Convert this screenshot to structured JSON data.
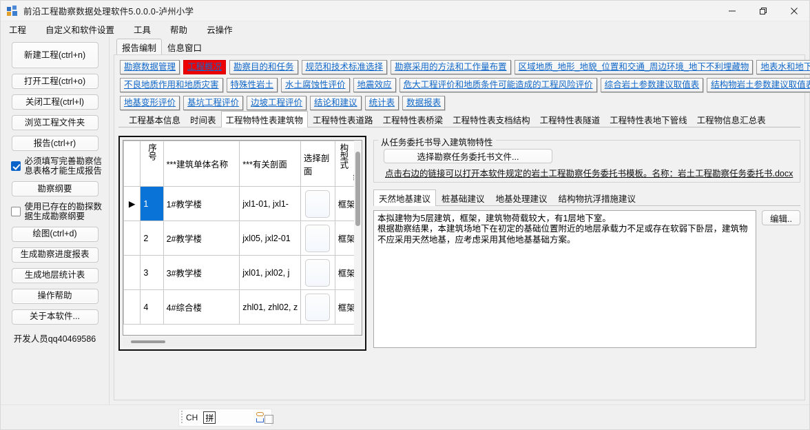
{
  "window": {
    "title": "前沿工程勘察数据处理软件5.0.0.0-泸州小学",
    "minimize": "—",
    "maximize": "❐",
    "close": "✕"
  },
  "menubar": {
    "items": [
      {
        "label": "工程"
      },
      {
        "label": "自定义和软件设置"
      },
      {
        "label": "工具"
      },
      {
        "label": "帮助"
      },
      {
        "label": "云操作"
      }
    ]
  },
  "sidebar": {
    "buttons": [
      {
        "label": "新建工程(ctrl+n)"
      },
      {
        "label": "打开工程(ctrl+o)"
      },
      {
        "label": "关闭工程(ctrl+l)"
      },
      {
        "label": "浏览工程文件夹"
      },
      {
        "label": "报告(ctrl+r)"
      }
    ],
    "checkbox_required": {
      "label": "必须填写完善勘察信息表格才能生成报告",
      "checked": true
    },
    "outline_button": {
      "label": "勘察纲要"
    },
    "checkbox_existing": {
      "label": "使用已存在的勘探数据生成勘察纲要",
      "checked": false
    },
    "buttons2": [
      {
        "label": "绘图(ctrl+d)"
      },
      {
        "label": "生成勘察进度报表"
      },
      {
        "label": "生成地层统计表"
      },
      {
        "label": "操作帮助"
      },
      {
        "label": "关于本软件..."
      }
    ],
    "developer": "开发人员qq40469586"
  },
  "outer_tabs": [
    {
      "label": "报告编制",
      "active": true
    },
    {
      "label": "信息窗口",
      "active": false
    }
  ],
  "nav_rows": [
    [
      {
        "label": "勘察数据管理",
        "hot": false
      },
      {
        "label": "工程概况",
        "hot": true
      },
      {
        "label": "勘察目的和任务",
        "hot": false
      },
      {
        "label": "规范和技术标准选择",
        "hot": false
      },
      {
        "label": "勘察采用的方法和工作量布置",
        "hot": false
      },
      {
        "label": "区域地质_地形_地貌_位置和交通_周边环境_地下不利埋藏物",
        "hot": false
      },
      {
        "label": "地表水和地下水",
        "hot": false
      }
    ],
    [
      {
        "label": "不良地质作用和地质灾害",
        "hot": false
      },
      {
        "label": "特殊性岩土",
        "hot": false
      },
      {
        "label": "水土腐蚀性评价",
        "hot": false
      },
      {
        "label": "地震效应",
        "hot": false
      },
      {
        "label": "危大工程评价和地质条件可能造成的工程风险评价",
        "hot": false
      },
      {
        "label": "综合岩土参数建议取值表",
        "hot": false
      },
      {
        "label": "结构物岩土参数建议取值表",
        "hot": false
      }
    ],
    [
      {
        "label": "地基变形评价",
        "hot": false
      },
      {
        "label": "基坑工程评价",
        "hot": false
      },
      {
        "label": "边坡工程评价",
        "hot": false
      },
      {
        "label": "结论和建议",
        "hot": false
      },
      {
        "label": "统计表",
        "hot": false
      },
      {
        "label": "数据报表",
        "hot": false
      }
    ]
  ],
  "inner_tabs": [
    {
      "label": "工程基本信息",
      "active": false
    },
    {
      "label": "时间表",
      "active": false
    },
    {
      "label": "工程物特性表建筑物",
      "active": true
    },
    {
      "label": "工程特性表道路",
      "active": false
    },
    {
      "label": "工程特性表桥梁",
      "active": false
    },
    {
      "label": "工程特性表支档结构",
      "active": false
    },
    {
      "label": "工程特性表隧道",
      "active": false
    },
    {
      "label": "工程特性表地下管线",
      "active": false
    },
    {
      "label": "工程物信息汇总表",
      "active": false
    }
  ],
  "grid": {
    "headers": [
      "",
      "序号",
      "***建筑单体名称",
      "***有关剖面",
      "选择剖面",
      "***结构型式"
    ],
    "rows": [
      {
        "indicator": "▶",
        "no": "1",
        "name": "1#教学楼",
        "sections": "jxl1-01, jxl1-",
        "pick": "",
        "type": "框架",
        "selected": true
      },
      {
        "indicator": "",
        "no": "2",
        "name": "2#教学楼",
        "sections": "jxl05, jxl2-01",
        "pick": "",
        "type": "框架",
        "selected": false
      },
      {
        "indicator": "",
        "no": "3",
        "name": "3#教学楼",
        "sections": "jxl01, jxl02, j",
        "pick": "",
        "type": "框架",
        "selected": false
      },
      {
        "indicator": "",
        "no": "4",
        "name": "4#综合楼",
        "sections": "zhl01, zhl02, z",
        "pick": "",
        "type": "框架",
        "selected": false
      }
    ]
  },
  "import_group": {
    "legend": "从任务委托书导入建筑物特性",
    "choose_button": "选择勘察任务委托书文件...",
    "template_link": "点击右边的链接可以打开本软件规定的岩土工程勘察任务委托书模板。名称：岩土工程勘察任务委托书.docx"
  },
  "suggestion_tabs": [
    {
      "label": "天然地基建议",
      "active": true
    },
    {
      "label": "桩基础建议",
      "active": false
    },
    {
      "label": "地基处理建议",
      "active": false
    },
    {
      "label": "结构物抗浮措施建议",
      "active": false
    }
  ],
  "suggestion_text": "本拟建物为5层建筑，框架，建筑物荷载较大，有1层地下室。\n根据勘察结果，本建筑场地下在初定的基础位置附近的地层承载力不足或存在软弱下卧层，建筑物不应采用天然地基，应考虑采用其他地基基础方案。",
  "edit_button": "编辑..",
  "statusbar": {
    "ime_mode": "CH",
    "ime_pinyin": "拼"
  },
  "colors": {
    "accent_blue": "#1268c8",
    "hot_red": "#ee0000",
    "selection_blue": "#0a73d8",
    "checkbox_blue": "#0a63c9"
  }
}
